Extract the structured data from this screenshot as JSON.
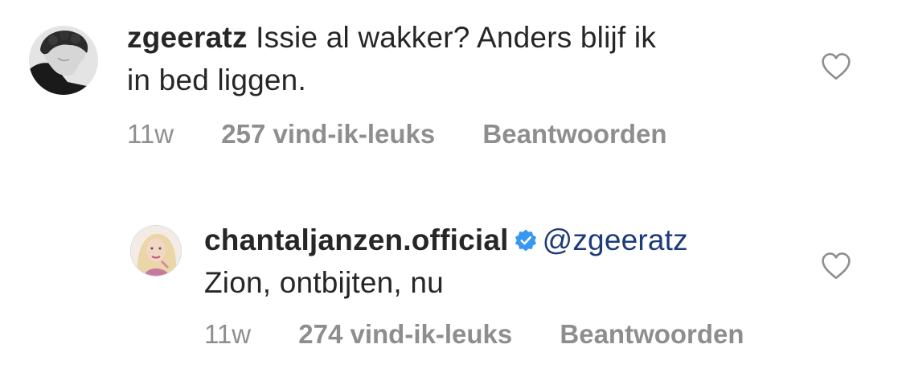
{
  "comments": [
    {
      "username": "zgeeratz",
      "text": "Issie al wakker? Anders blijf ik in bed liggen.",
      "text_line1": "Issie al wakker? Anders blijf ik",
      "text_line2": "in bed liggen.",
      "time": "11w",
      "likes": "257 vind-ik-leuks",
      "reply_label": "Beantwoorden",
      "avatar_icon": "avatar-icon",
      "like_icon": "heart-outline-icon"
    },
    {
      "username": "chantaljanzen.official",
      "verified": true,
      "mention": "@zgeeratz",
      "text": "Zion, ontbijten, nu",
      "time": "11w",
      "likes": "274 vind-ik-leuks",
      "reply_label": "Beantwoorden",
      "avatar_icon": "avatar-icon",
      "verified_icon": "verified-badge-icon",
      "like_icon": "heart-outline-icon"
    }
  ],
  "colors": {
    "text": "#262626",
    "muted": "#8e8e8e",
    "mention": "#1d3a7a",
    "verified": "#3897f0",
    "heart_stroke": "#8e8e8e"
  }
}
